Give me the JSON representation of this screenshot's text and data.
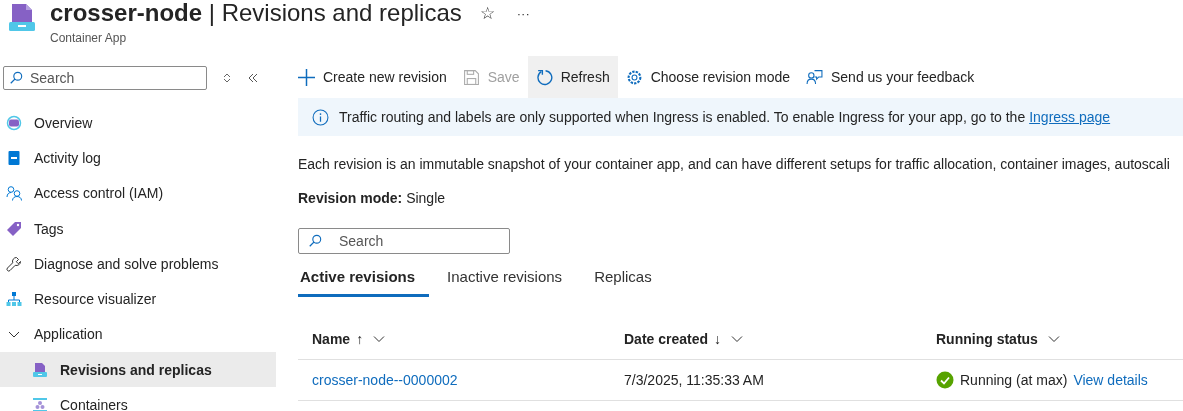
{
  "header": {
    "title": "**crosser-node** | Revisions and replicas",
    "subtitle": "Container App",
    "favorite": "☆",
    "more": "···"
  },
  "sidebar": {
    "search": {
      "placeholder": "Search"
    },
    "items": [
      {
        "label": "Overview",
        "selected": false
      },
      {
        "label": "Activity log",
        "selected": false
      },
      {
        "label": "Access control (IAM)",
        "selected": false
      },
      {
        "label": "Tags",
        "selected": false
      },
      {
        "label": "Diagnose and solve problems",
        "selected": false
      },
      {
        "label": "Resource visualizer",
        "selected": false
      },
      {
        "label": "Application",
        "selected": false,
        "expanded": true,
        "children": [
          {
            "label": "Revisions and replicas",
            "selected": true
          },
          {
            "label": "Containers",
            "selected": false
          }
        ]
      }
    ]
  },
  "toolbar": [
    {
      "label": "Create new revision",
      "disabled": false,
      "active": false
    },
    {
      "label": "Save",
      "disabled": true,
      "active": false
    },
    {
      "label": "Refresh",
      "disabled": false,
      "active": true
    },
    {
      "label": "Choose revision mode",
      "disabled": false,
      "active": false
    },
    {
      "label": "Send us your feedback",
      "disabled": false,
      "active": false
    }
  ],
  "banner": {
    "text": "Traffic routing and labels are only supported when Ingress is enabled. To enable Ingress for your app, go to the",
    "link": "Ingress page"
  },
  "description": "Each revision is an immutable snapshot of your container app, and can have different setups for traffic allocation, container images, autoscali",
  "revision_mode": "**Revision mode:** Single",
  "search": {
    "placeholder": "Search"
  },
  "tabs": [
    {
      "label": "Active revisions",
      "selected": true
    },
    {
      "label": "Inactive revisions",
      "selected": false
    },
    {
      "label": "Replicas",
      "selected": false
    }
  ],
  "table": {
    "columns": [
      {
        "label": "Name",
        "sort": "↑"
      },
      {
        "label": "Date created",
        "sort": "↓"
      },
      {
        "label": "Running status"
      }
    ],
    "rows": [
      {
        "name": "crosser-node--0000002",
        "date": "7/3/2025, 11:35:33 AM",
        "status": "Running (at max)",
        "ok": true,
        "details": "View details"
      }
    ]
  }
}
